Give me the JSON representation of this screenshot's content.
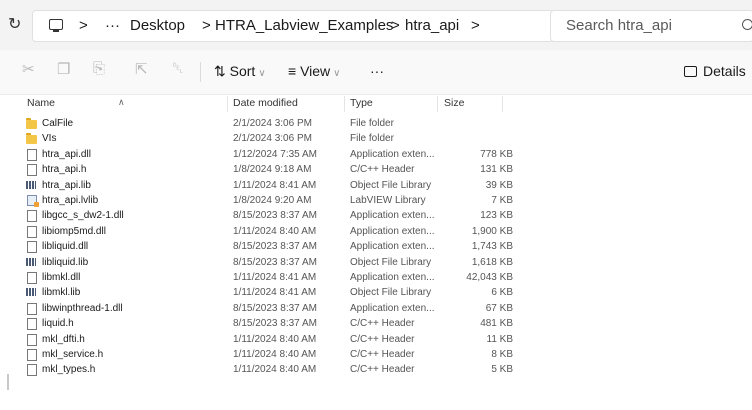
{
  "address": {
    "crumbs": [
      ">",
      "···",
      "Desktop",
      ">",
      "HTRA_Labview_Examples",
      ">",
      "htra_api",
      ">"
    ]
  },
  "search": {
    "placeholder": "Search htra_api"
  },
  "toolbar": {
    "sort_label": "Sort",
    "view_label": "View",
    "more_label": "···",
    "details_label": "Details"
  },
  "columns": {
    "name": "Name",
    "date": "Date modified",
    "type": "Type",
    "size": "Size"
  },
  "files": [
    {
      "name": "CalFile",
      "date": "2/1/2024 3:06 PM",
      "type": "File folder",
      "size": "",
      "icon": "folder-icon"
    },
    {
      "name": "VIs",
      "date": "2/1/2024 3:06 PM",
      "type": "File folder",
      "size": "",
      "icon": "folder-icon"
    },
    {
      "name": "htra_api.dll",
      "date": "1/12/2024 7:35 AM",
      "type": "Application exten...",
      "size": "778 KB",
      "icon": "dll-file-icon"
    },
    {
      "name": "htra_api.h",
      "date": "1/8/2024 9:18 AM",
      "type": "C/C++ Header",
      "size": "131 KB",
      "icon": "header-file-icon"
    },
    {
      "name": "htra_api.lib",
      "date": "1/11/2024 8:41 AM",
      "type": "Object File Library",
      "size": "39 KB",
      "icon": "lib-file-icon"
    },
    {
      "name": "htra_api.lvlib",
      "date": "1/8/2024 9:20 AM",
      "type": "LabVIEW Library",
      "size": "7 KB",
      "icon": "labview-library-icon"
    },
    {
      "name": "libgcc_s_dw2-1.dll",
      "date": "8/15/2023 8:37 AM",
      "type": "Application exten...",
      "size": "123 KB",
      "icon": "dll-file-icon"
    },
    {
      "name": "libiomp5md.dll",
      "date": "1/11/2024 8:40 AM",
      "type": "Application exten...",
      "size": "1,900 KB",
      "icon": "dll-file-icon"
    },
    {
      "name": "libliquid.dll",
      "date": "8/15/2023 8:37 AM",
      "type": "Application exten...",
      "size": "1,743 KB",
      "icon": "dll-file-icon"
    },
    {
      "name": "libliquid.lib",
      "date": "8/15/2023 8:37 AM",
      "type": "Object File Library",
      "size": "1,618 KB",
      "icon": "lib-file-icon"
    },
    {
      "name": "libmkl.dll",
      "date": "1/11/2024 8:41 AM",
      "type": "Application exten...",
      "size": "42,043 KB",
      "icon": "dll-file-icon"
    },
    {
      "name": "libmkl.lib",
      "date": "1/11/2024 8:41 AM",
      "type": "Object File Library",
      "size": "6 KB",
      "icon": "lib-file-icon"
    },
    {
      "name": "libwinpthread-1.dll",
      "date": "8/15/2023 8:37 AM",
      "type": "Application exten...",
      "size": "67 KB",
      "icon": "dll-file-icon"
    },
    {
      "name": "liquid.h",
      "date": "8/15/2023 8:37 AM",
      "type": "C/C++ Header",
      "size": "481 KB",
      "icon": "header-file-icon"
    },
    {
      "name": "mkl_dfti.h",
      "date": "1/11/2024 8:40 AM",
      "type": "C/C++ Header",
      "size": "11 KB",
      "icon": "header-file-icon"
    },
    {
      "name": "mkl_service.h",
      "date": "1/11/2024 8:40 AM",
      "type": "C/C++ Header",
      "size": "8 KB",
      "icon": "header-file-icon"
    },
    {
      "name": "mkl_types.h",
      "date": "1/11/2024 8:40 AM",
      "type": "C/C++ Header",
      "size": "5 KB",
      "icon": "header-file-icon"
    }
  ],
  "colors": {
    "folder": "#f4c648",
    "background": "#ffffff",
    "toolbar": "#f3f3f3"
  }
}
